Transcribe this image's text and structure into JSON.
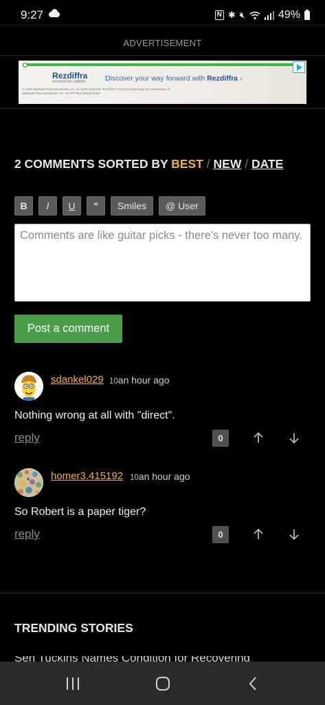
{
  "status_bar": {
    "time": "9:27",
    "battery": "49%",
    "icons": [
      "cloud-icon",
      "nfc-icon",
      "bluetooth-icon",
      "mute-icon",
      "wifi-icon",
      "signal-icon",
      "battery-icon"
    ]
  },
  "ad": {
    "label": "ADVERTISEMENT",
    "brand": "Rezdiffra",
    "brand_sub": "resmetirom tablets",
    "cta_prefix": "Discover your way forward with",
    "cta_brand": "Rezdiffra",
    "fine_print": "© 2024 Madrigal Pharmaceuticals, Inc. All rights reserved. Rezdiffra™ and its related logo are trademarks of Madrigal Pharmaceuticals, Inc. US-PP-RES-00238 07/24"
  },
  "comments_section": {
    "count_label": "2 COMMENTS SORTED BY",
    "sort_best": "BEST",
    "sort_new": "NEW",
    "sort_date": "DATE",
    "separator": "/"
  },
  "editor": {
    "toolbar": {
      "bold": "B",
      "italic": "I",
      "underline": "U",
      "quote": "”",
      "smiles": "Smiles",
      "user": "@ User"
    },
    "placeholder": "Comments are like guitar picks - there's never too many.",
    "post_button": "Post a comment"
  },
  "comments": [
    {
      "author": "sdankel029",
      "score": "10",
      "time": "an hour ago",
      "body": "Nothing wrong at all with \"direct\".",
      "reply": "reply",
      "votes": "0"
    },
    {
      "author": "homer3.415192",
      "score": "10",
      "time": "an hour ago",
      "body": "So Robert is a paper tiger?",
      "reply": "reply",
      "votes": "0"
    }
  ],
  "trending": {
    "heading": "TRENDING STORIES",
    "first_story_peek": "Sen Tuckins Names Condition for Recovering"
  },
  "colors": {
    "accent": "#f3b13a",
    "post_button": "#4a9e4a",
    "background": "#000000"
  }
}
